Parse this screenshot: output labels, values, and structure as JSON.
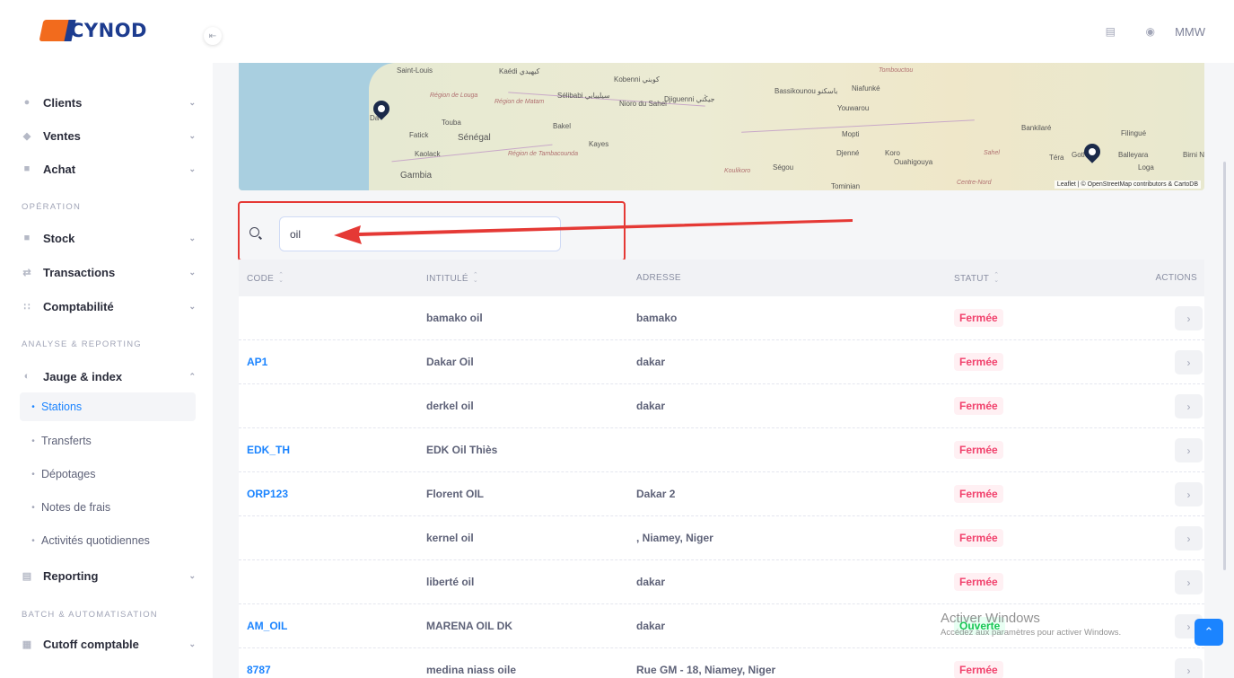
{
  "brand": {
    "name": "CYNOD"
  },
  "header": {
    "user_initials": "MMW"
  },
  "sidebar": {
    "groups_top": [
      {
        "label": "Clients",
        "icon": "users-icon"
      },
      {
        "label": "Ventes",
        "icon": "cart-icon"
      },
      {
        "label": "Achat",
        "icon": "basket-icon"
      }
    ],
    "section_operation": "OPÉRATION",
    "operation_items": [
      {
        "label": "Stock",
        "icon": "box-icon"
      },
      {
        "label": "Transactions",
        "icon": "exchange-icon"
      },
      {
        "label": "Comptabilité",
        "icon": "grid-icon"
      }
    ],
    "section_analysis": "ANALYSE & REPORTING",
    "analysis_item": {
      "label": "Jauge & index",
      "icon": "gauge-icon"
    },
    "sub_items": [
      "Stations",
      "Transferts",
      "Dépotages",
      "Notes de frais",
      "Activités quotidiennes"
    ],
    "active_sub": "Stations",
    "reporting": {
      "label": "Reporting",
      "icon": "chart-icon"
    },
    "section_batch": "BATCH & AUTOMATISATION",
    "batch_item": {
      "label": "Cutoff comptable",
      "icon": "calendar-icon"
    }
  },
  "map": {
    "labels": [
      "Saint-Louis",
      "Kaédi كيهيدي",
      "Région de Louga",
      "Région de Matam",
      "Sélibabi سيليبابي",
      "Kobenni كوبني",
      "Nioro du Sahel",
      "Djiguenni جيڭني",
      "Bassikounou باسكنو",
      "Niafunké",
      "Tombouctou",
      "Youwarou",
      "Touba",
      "Fatick",
      "Sénégal",
      "Kaolack",
      "Région de Tambacounda",
      "Bakel",
      "Kayes",
      "Ségou",
      "Djenné",
      "Mopti",
      "Koro",
      "Ouahigouya",
      "Sahel",
      "Koulikoro",
      "Gambia",
      "Tominian",
      "Centre-Nord",
      "Bankilaré",
      "Filingué",
      "Téra",
      "Gothèye",
      "Balleyara",
      "Loga",
      "Birni N",
      "Da"
    ],
    "attribution": "Leaflet | © OpenStreetMap contributors & CartoDB"
  },
  "search": {
    "value": "oil"
  },
  "table": {
    "headers": {
      "code": "CODE",
      "name": "INTITULÉ",
      "address": "ADRESSE",
      "status": "STATUT",
      "actions": "ACTIONS"
    },
    "rows": [
      {
        "code": "",
        "name": "bamako oil",
        "address": "bamako",
        "status": "Fermée"
      },
      {
        "code": "AP1",
        "name": "Dakar Oil",
        "address": "dakar",
        "status": "Fermée"
      },
      {
        "code": "",
        "name": "derkel oil",
        "address": "dakar",
        "status": "Fermée"
      },
      {
        "code": "EDK_TH",
        "name": "EDK Oil Thiès",
        "address": "",
        "status": "Fermée"
      },
      {
        "code": "ORP123",
        "name": "Florent OIL",
        "address": "Dakar 2",
        "status": "Fermée"
      },
      {
        "code": "",
        "name": "kernel oil",
        "address": ", Niamey, Niger",
        "status": "Fermée"
      },
      {
        "code": "",
        "name": "liberté oil",
        "address": "dakar",
        "status": "Fermée"
      },
      {
        "code": "AM_OIL",
        "name": "MARENA OIL DK",
        "address": "dakar",
        "status": "Ouverte"
      },
      {
        "code": "8787",
        "name": "medina niass oile",
        "address": "Rue GM - 18, Niamey, Niger",
        "status": "Fermée"
      }
    ]
  },
  "watermark": {
    "title": "Activer Windows",
    "subtitle": "Accédez aux paramètres pour activer Windows."
  },
  "colors": {
    "accent": "#1b84ff",
    "danger": "#f1416c",
    "success": "#17c653",
    "brand_orange": "#f26b1d",
    "brand_blue": "#1d3c8f"
  }
}
